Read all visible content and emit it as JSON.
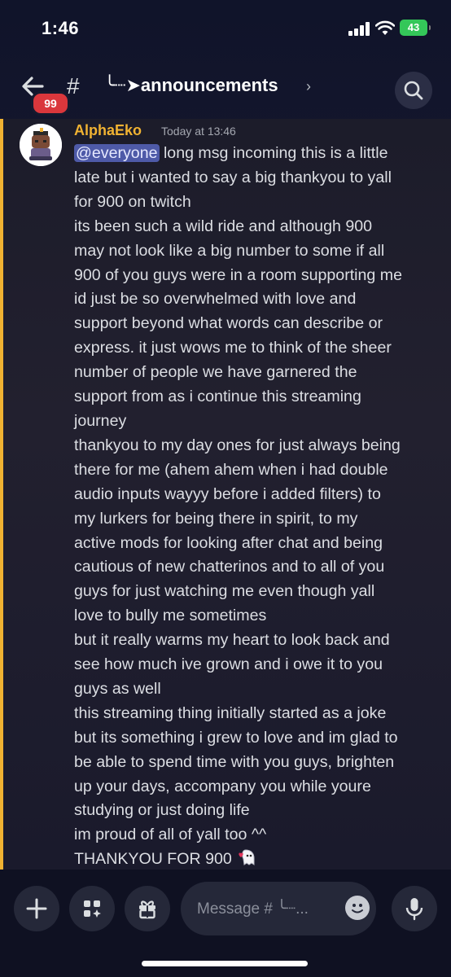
{
  "status_bar": {
    "time": "1:46",
    "battery": "43"
  },
  "header": {
    "badge": "99",
    "hash": "#",
    "channel_name": "╰┈➤announcements",
    "chevron": "›"
  },
  "message": {
    "author": "AlphaEko",
    "timestamp": "Today at 13:46",
    "mention": "@everyone",
    "first_line_rest": " long msg incoming this is a little",
    "lines": [
      "late but i wanted to say a big thankyou to yall",
      "for 900 on twitch",
      "its been such a wild ride and although 900",
      "may not look like a big number to some if all",
      "900 of you guys were in a room supporting me",
      "id just be so overwhelmed with love and",
      "support beyond what words can describe or",
      "express. it just wows me to think of the sheer",
      "number of people we have garnered the",
      "support from as i continue this streaming",
      "journey",
      "thankyou to my day ones for just always being",
      "there for me (ahem ahem when i had double",
      "audio inputs wayyy before i added filters) to",
      "my lurkers for being there in spirit, to my",
      "active mods for looking after chat and being",
      "cautious of new chatterinos and to all of you",
      "guys for just watching me even though yall",
      "love to bully me sometimes",
      "but it really warms my heart to look back and",
      "see how much ive grown and i owe it to you",
      "guys as well",
      "this streaming thing initially started as a joke",
      "but its something i grew to love and im glad to",
      "be able to spend time with you guys, brighten",
      "up your days, accompany you while youre",
      "studying or just doing life",
      "im proud of all of yall too ^^"
    ],
    "last_line": "THANKYOU FOR 900 "
  },
  "composer": {
    "placeholder": "Message # ╰┈...",
    "icons": [
      "plus-icon",
      "apps-icon",
      "gift-icon",
      "emoji-icon",
      "microphone-icon"
    ]
  },
  "colors": {
    "background": "#15192e",
    "username": "#f0b232",
    "mention_bg": "#4e5aa8",
    "badge": "#da373c",
    "battery": "#34c759"
  }
}
